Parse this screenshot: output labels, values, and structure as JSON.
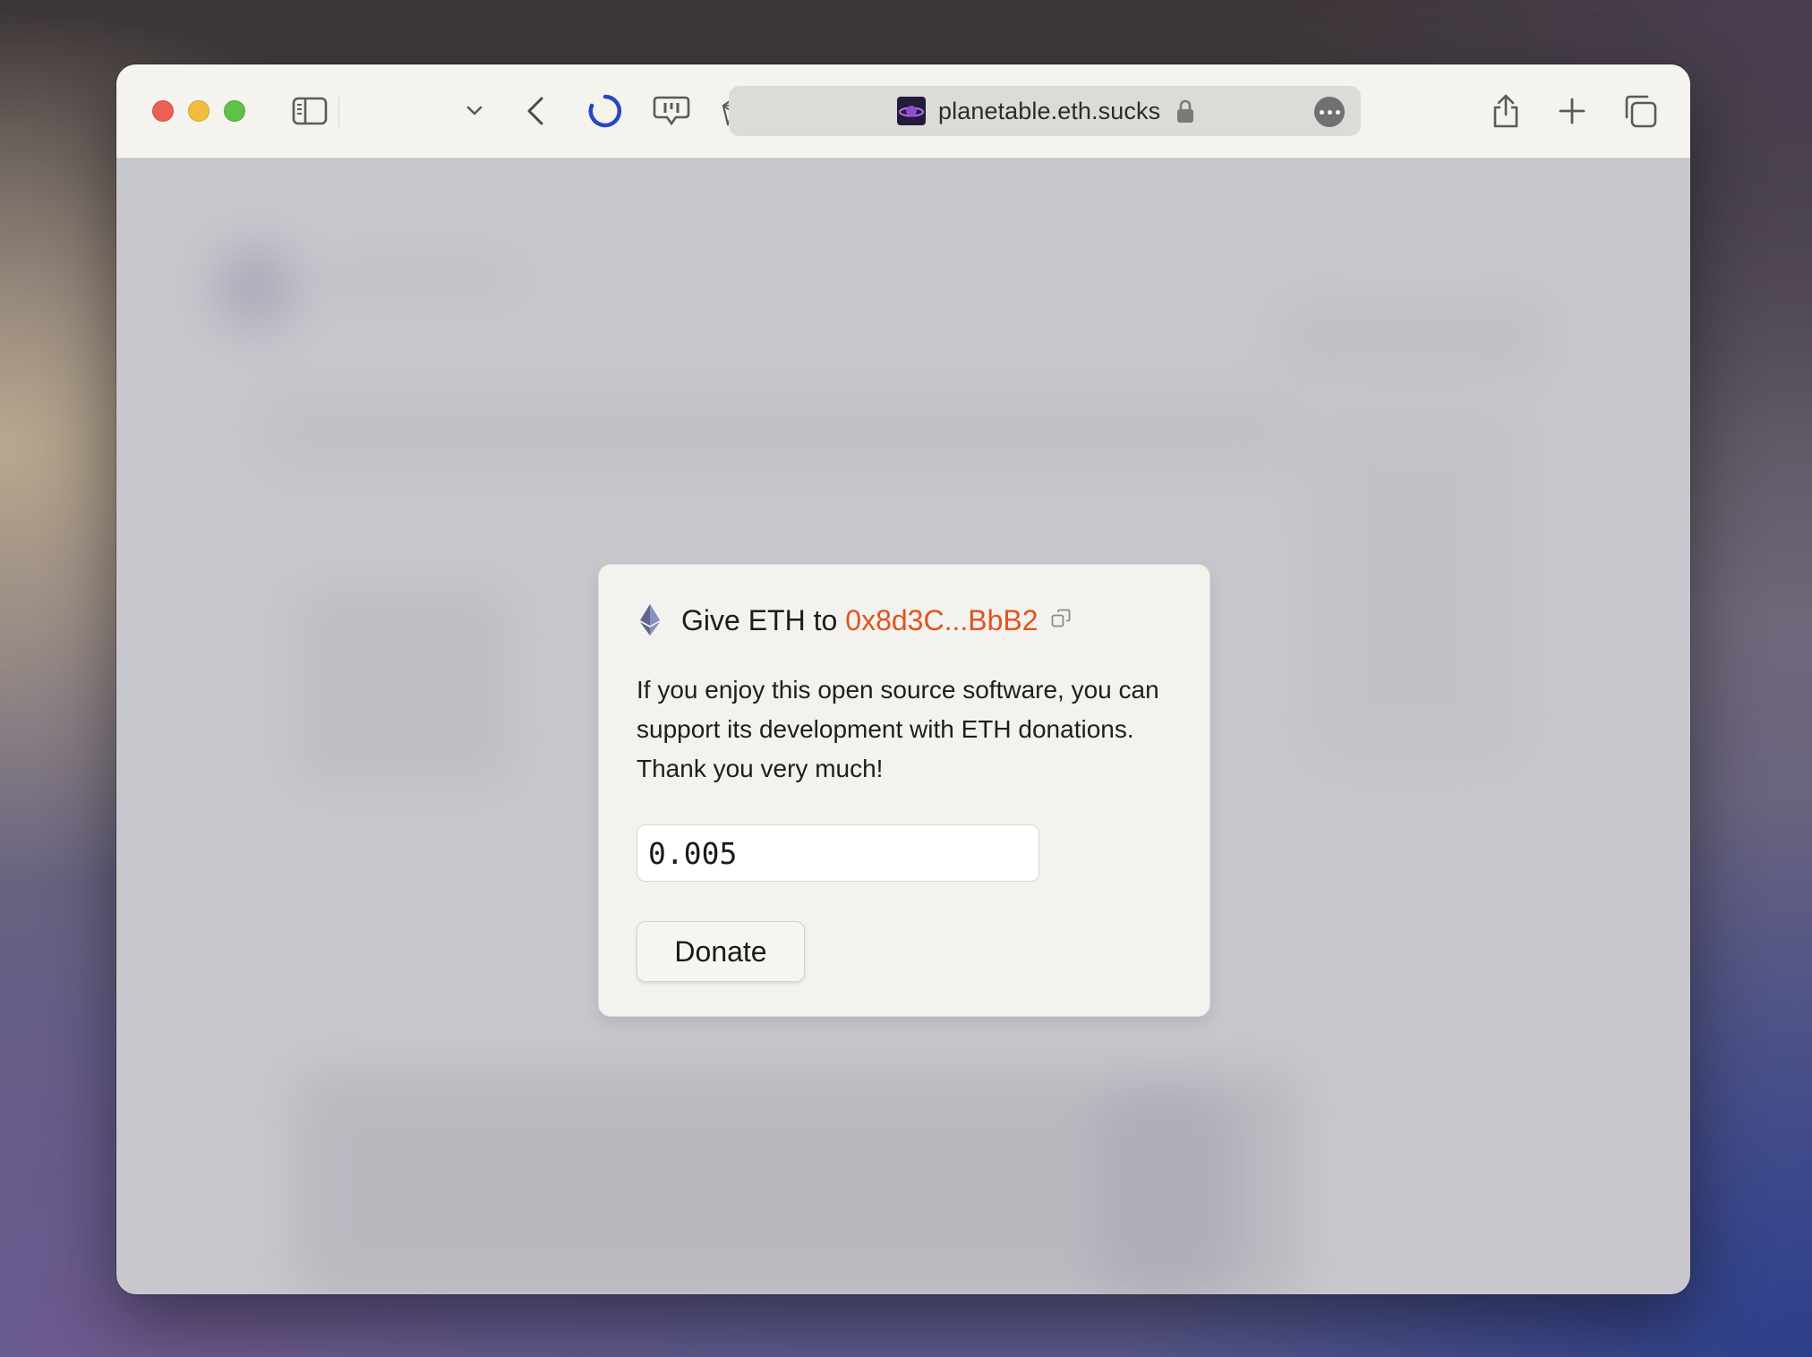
{
  "browser": {
    "url_domain": "planetable.eth.sucks",
    "icons": [
      "sidebar-icon",
      "chevron-down-icon",
      "back-icon",
      "loading-spinner-icon",
      "extension-icon",
      "extension-icon",
      "record-icon",
      "lock-icon",
      "more-icon",
      "share-icon",
      "plus-icon",
      "tabs-icon"
    ]
  },
  "dialog": {
    "title_prefix": "Give ETH to",
    "address": "0x8d3C...BbB2",
    "description": "If you enjoy this open source software, you can support its development with ETH donations. Thank you very much!",
    "amount_value": "0.005",
    "donate_label": "Donate"
  },
  "colors": {
    "accent_address": "#e0541f",
    "spinner_blue": "#2347c6",
    "traffic_red": "#ec5f56",
    "traffic_yellow": "#f2bd3c",
    "traffic_green": "#5ec148"
  }
}
